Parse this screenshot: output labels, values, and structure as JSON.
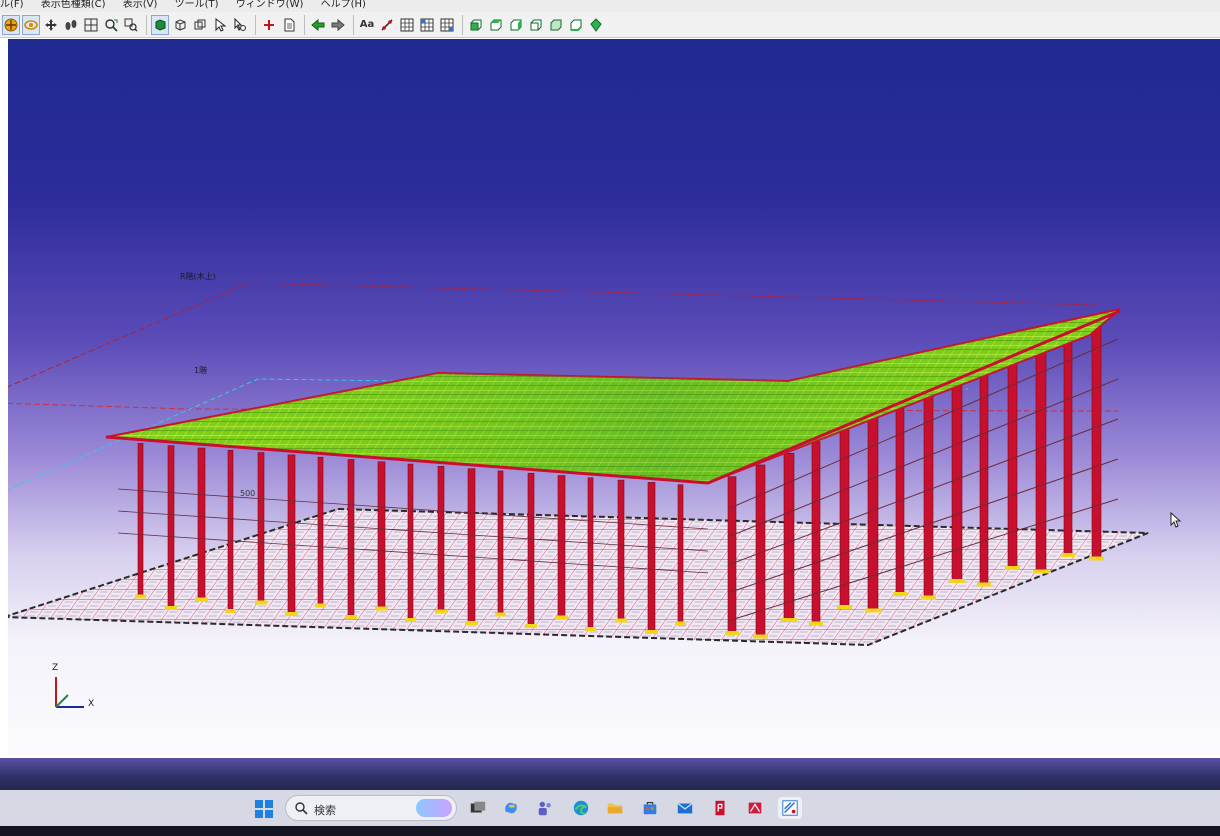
{
  "menu": {
    "items": [
      "ル(F)",
      "表示色種類(C)",
      "表示(V)",
      "ツール(T)",
      "ウィンドウ(W)",
      "ヘルプ(H)"
    ]
  },
  "toolbar": {
    "text_tool_label": "Aa",
    "icons": [
      "pan-icon",
      "rotate-icon",
      "move-icon",
      "walk-icon",
      "grid-icon",
      "zoom-window-icon",
      "zoom-icon",
      "solid-view-icon",
      "wire-view-icon",
      "hidden-line-icon",
      "select-icon",
      "zoom-select-icon",
      "add-icon",
      "page-icon",
      "back-arrow-icon",
      "forward-arrow-icon",
      "text-icon",
      "measure-icon",
      "table1-icon",
      "table2-icon",
      "table3-icon",
      "view-front-icon",
      "view-back-icon",
      "view-left-icon",
      "view-right-icon",
      "view-top-icon",
      "view-bottom-icon",
      "view-iso-icon"
    ]
  },
  "viewport": {
    "label_top": "R階(木上)",
    "label_mid": "1階",
    "label_dim": "500",
    "axis_z": "Z",
    "axis_x": "X"
  },
  "taskbar": {
    "search_label": "検索",
    "icons": [
      "windows-start-icon",
      "search-icon",
      "task-view-icon",
      "copilot-icon",
      "teams-icon",
      "edge-icon",
      "file-explorer-icon",
      "store-icon",
      "mail-icon",
      "app-icon-1",
      "app-icon-2",
      "structural-app-icon"
    ]
  },
  "colors": {
    "roof": "#7fcf1a",
    "column": "#c8102e",
    "background_top": "#1f2a90"
  }
}
